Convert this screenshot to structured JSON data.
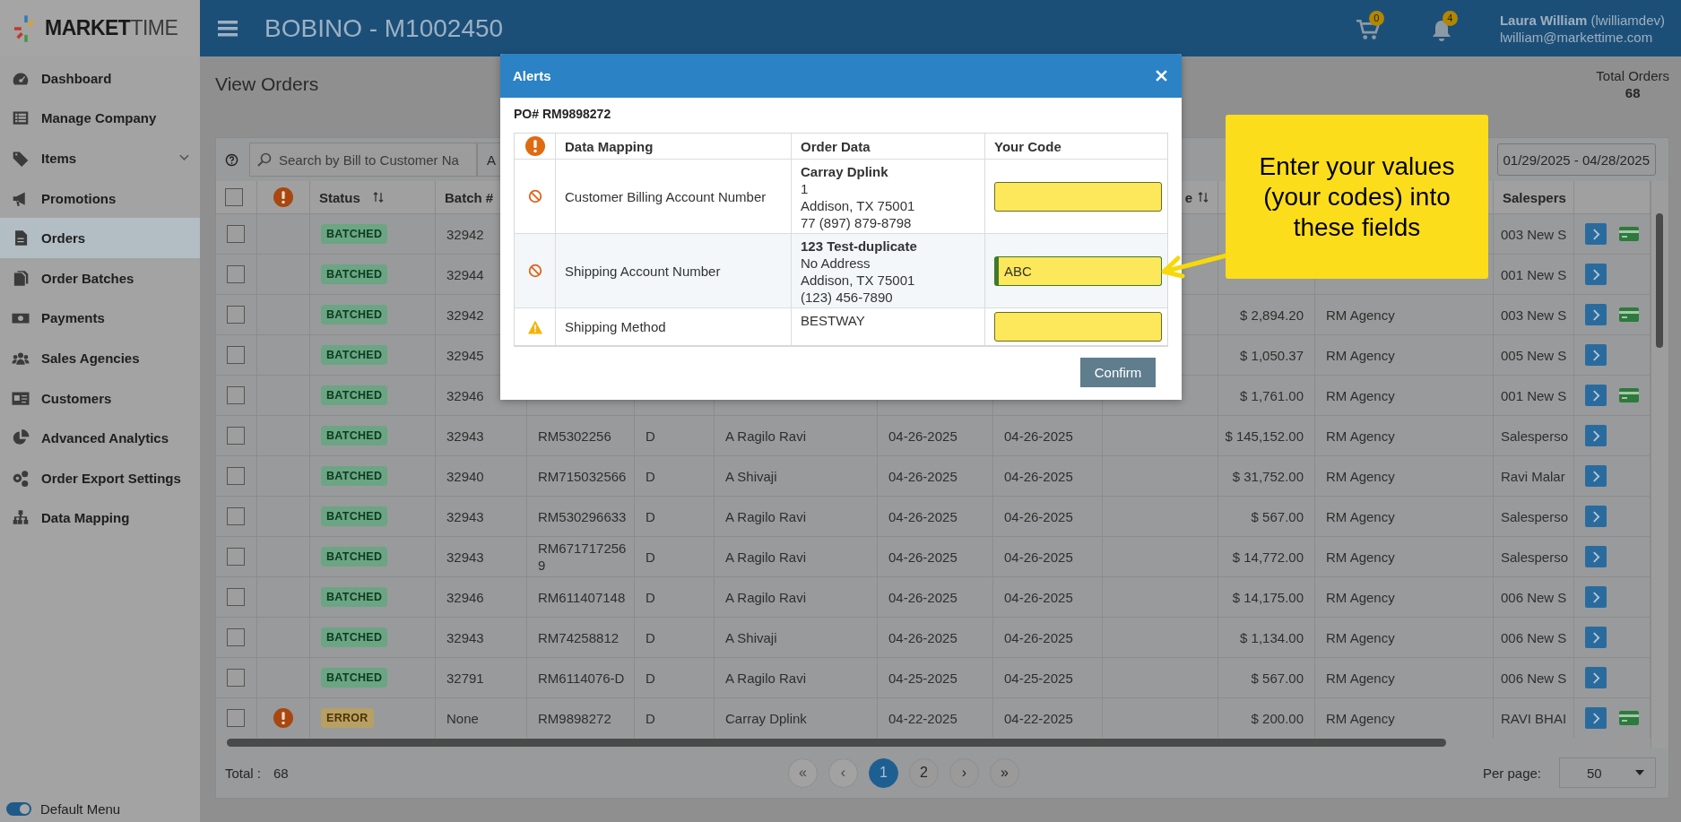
{
  "logo": {
    "strong": "MARKET",
    "light": "TIME"
  },
  "header": {
    "title": "BOBINO - M1002450",
    "cart_count": "0",
    "notification_count": "4",
    "user": "**Laura William** (lwilliamdev)",
    "email": "lwilliam@markettime.com"
  },
  "sidebar": {
    "items": [
      {
        "label": "Dashboard",
        "selected": false,
        "has_submenu": false
      },
      {
        "label": "Manage Company",
        "selected": false,
        "has_submenu": false
      },
      {
        "label": "Items",
        "selected": false,
        "has_submenu": true
      },
      {
        "label": "Promotions",
        "selected": false,
        "has_submenu": false
      },
      {
        "label": "Orders",
        "selected": true,
        "has_submenu": false
      },
      {
        "label": "Order Batches",
        "selected": false,
        "has_submenu": false
      },
      {
        "label": "Payments",
        "selected": false,
        "has_submenu": false
      },
      {
        "label": "Sales Agencies",
        "selected": false,
        "has_submenu": false
      },
      {
        "label": "Customers",
        "selected": false,
        "has_submenu": false
      },
      {
        "label": "Advanced Analytics",
        "selected": false,
        "has_submenu": false
      },
      {
        "label": "Order Export Settings",
        "selected": false,
        "has_submenu": false
      },
      {
        "label": "Data Mapping",
        "selected": false,
        "has_submenu": false
      }
    ],
    "toggle": {
      "label": "Default Menu",
      "on": true
    }
  },
  "page": {
    "title": "View Orders",
    "total_label": "Total Orders",
    "total_value": "68"
  },
  "toolbar": {
    "search_placeholder": "Search by Bill to Customer Na",
    "filter_text": "A",
    "date_range": "01/29/2025 - 04/28/2025"
  },
  "table": {
    "select_all": {
      "checked": false
    },
    "columns": [
      {
        "kind": "checkbox"
      },
      {
        "kind": "alert"
      },
      {
        "kind": "text",
        "label": "Status",
        "sortable": true
      },
      {
        "kind": "text",
        "label": "Batch #"
      },
      {
        "kind": "blank"
      },
      {
        "kind": "blank"
      },
      {
        "kind": "blank"
      },
      {
        "kind": "blank"
      },
      {
        "kind": "blank"
      },
      {
        "kind": "text",
        "label": "e",
        "sortable": true
      },
      {
        "kind": "blank"
      },
      {
        "kind": "blank"
      },
      {
        "kind": "text",
        "label": "Salespers"
      },
      {
        "kind": "blank"
      }
    ],
    "rows": [
      {
        "checked": false,
        "alert": false,
        "status": "BATCHED",
        "status_error": false,
        "batch": "32942",
        "salesperson": "003 New S",
        "card": true
      },
      {
        "checked": false,
        "alert": false,
        "status": "BATCHED",
        "status_error": false,
        "batch": "32944",
        "salesperson": "001 New S",
        "card": false
      },
      {
        "checked": false,
        "alert": false,
        "status": "BATCHED",
        "status_error": false,
        "batch": "32942",
        "amount": "$ 2,894.20",
        "agency": "RM Agency",
        "salesperson": "003 New S",
        "card": true
      },
      {
        "checked": false,
        "alert": false,
        "status": "BATCHED",
        "status_error": false,
        "batch": "32945",
        "amount": "$ 1,050.37",
        "agency": "RM Agency",
        "salesperson": "005 New S",
        "card": false
      },
      {
        "checked": false,
        "alert": false,
        "status": "BATCHED",
        "status_error": false,
        "batch": "32946",
        "amount": "$ 1,761.00",
        "agency": "RM Agency",
        "salesperson": "001 New S",
        "card": true
      },
      {
        "checked": false,
        "alert": false,
        "status": "BATCHED",
        "status_error": false,
        "batch": "32943",
        "po": "RM5302256",
        "type": "D",
        "customer": "A Ragilo Ravi",
        "date_1": "04-26-2025",
        "date_2": "04-26-2025",
        "amount": "$ 145,152.00",
        "agency": "RM Agency",
        "salesperson": "Salesperso",
        "card": false
      },
      {
        "checked": false,
        "alert": false,
        "status": "BATCHED",
        "status_error": false,
        "batch": "32940",
        "po": "RM715032566",
        "type": "D",
        "customer": "A Shivaji",
        "date_1": "04-26-2025",
        "date_2": "04-26-2025",
        "amount": "$ 31,752.00",
        "agency": "RM Agency",
        "salesperson": "Ravi Malar",
        "card": false
      },
      {
        "checked": false,
        "alert": false,
        "status": "BATCHED",
        "status_error": false,
        "batch": "32943",
        "po": "RM530296633",
        "type": "D",
        "customer": "A Ragilo Ravi",
        "date_1": "04-26-2025",
        "date_2": "04-26-2025",
        "amount": "$ 567.00",
        "agency": "RM Agency",
        "salesperson": "Salesperso",
        "card": false
      },
      {
        "checked": false,
        "alert": false,
        "status": "BATCHED",
        "status_error": false,
        "batch": "32943",
        "po": "RM6717172569",
        "type": "D",
        "customer": "A Ragilo Ravi",
        "date_1": "04-26-2025",
        "date_2": "04-26-2025",
        "amount": "$ 14,772.00",
        "agency": "RM Agency",
        "salesperson": "Salesperso",
        "card": false
      },
      {
        "checked": false,
        "alert": false,
        "status": "BATCHED",
        "status_error": false,
        "batch": "32946",
        "po": "RM611407148",
        "type": "D",
        "customer": "A Ragilo Ravi",
        "date_1": "04-26-2025",
        "date_2": "04-26-2025",
        "amount": "$ 14,175.00",
        "agency": "RM Agency",
        "salesperson": "006 New S",
        "card": false
      },
      {
        "checked": false,
        "alert": false,
        "status": "BATCHED",
        "status_error": false,
        "batch": "32943",
        "po": "RM74258812",
        "type": "D",
        "customer": "A Shivaji",
        "date_1": "04-26-2025",
        "date_2": "04-26-2025",
        "amount": "$ 1,134.00",
        "agency": "RM Agency",
        "salesperson": "006 New S",
        "card": false
      },
      {
        "checked": false,
        "alert": false,
        "status": "BATCHED",
        "status_error": false,
        "batch": "32791",
        "po": "RM6114076-D",
        "type": "D",
        "customer": "A Ragilo Ravi",
        "date_1": "04-25-2025",
        "date_2": "04-25-2025",
        "amount": "$ 567.00",
        "agency": "RM Agency",
        "salesperson": "006 New S",
        "card": false
      },
      {
        "checked": false,
        "alert": true,
        "status": "ERROR",
        "status_error": true,
        "batch": "None",
        "po": "RM9898272",
        "type": "D",
        "customer": "Carray Dplink",
        "date_1": "04-22-2025",
        "date_2": "04-22-2025",
        "amount": "$ 200.00",
        "agency": "RM Agency",
        "salesperson": "RAVI BHAI",
        "card": true
      }
    ]
  },
  "footer": {
    "total_label": "Total :",
    "total_value": "68",
    "pages": [
      {
        "label": "«",
        "selected": false,
        "disabled": true
      },
      {
        "label": "‹",
        "selected": false,
        "disabled": true
      },
      {
        "label": "1",
        "selected": true,
        "disabled": false
      },
      {
        "label": "2",
        "selected": false,
        "disabled": false
      },
      {
        "label": "›",
        "selected": false,
        "disabled": false
      },
      {
        "label": "»",
        "selected": false,
        "disabled": false
      }
    ],
    "per_page_label": "Per page:",
    "per_page_value": "50"
  },
  "modal": {
    "title": "Alerts",
    "po": "PO# RM9898272",
    "columns": [
      "Data Mapping",
      "Order Data",
      "Your Code"
    ],
    "rows": [
      {
        "kind": "error",
        "highlighted": false,
        "mapping": "Customer Billing Account Number",
        "order_name": "Carray Dplink",
        "order_lines": [
          "1",
          "Addison, TX 75001",
          "77 (897) 879-8798"
        ],
        "focused": false
      },
      {
        "kind": "error",
        "highlighted": true,
        "mapping": "Shipping Account Number",
        "order_name": "123 Test-duplicate",
        "order_lines": [
          "No Address",
          "Addison, TX 75001",
          "(123) 456-7890"
        ],
        "value": "ABC",
        "focused": true
      },
      {
        "kind": "warning",
        "highlighted": false,
        "mapping": "Shipping Method",
        "order_lines": [
          "BESTWAY"
        ],
        "focused": false
      }
    ],
    "confirm": "Confirm"
  },
  "callout": {
    "text": "Enter your values (your codes) into these fields"
  }
}
